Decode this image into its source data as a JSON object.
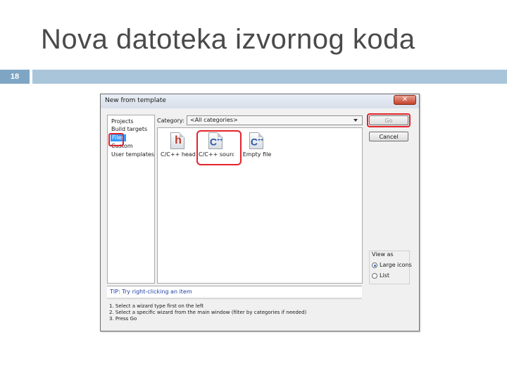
{
  "slide": {
    "title": "Nova datoteka izvornog koda",
    "number": "18"
  },
  "dialog": {
    "title": "New from template",
    "close_symbol": "✕",
    "left_items": [
      {
        "label": "Projects",
        "selected": false
      },
      {
        "label": "Build targets",
        "selected": false
      },
      {
        "label": "Files",
        "selected": true
      },
      {
        "label": "Custom",
        "selected": false
      },
      {
        "label": "User templates",
        "selected": false
      }
    ],
    "category_label": "Category:",
    "category_value": "<All categories>",
    "templates": [
      {
        "label": "C/C++ header",
        "glyph": "h",
        "icon": "header-file-icon"
      },
      {
        "label": "C/C++ source",
        "glyph": "C",
        "icon": "cpp-source-file-icon"
      },
      {
        "label": "Empty file",
        "glyph": "C",
        "icon": "empty-file-icon"
      }
    ],
    "buttons": {
      "go": "Go",
      "cancel": "Cancel"
    },
    "view_as": {
      "title": "View as",
      "options": [
        {
          "label": "Large icons",
          "checked": true
        },
        {
          "label": "List",
          "checked": false
        }
      ]
    },
    "tip": "TIP: Try right-clicking an item",
    "instructions": [
      "1. Select a wizard type first on the left",
      "2. Select a specific wizard from the main window (filter by categories if needed)",
      "3. Press Go"
    ],
    "highlight_color": "#e3232c"
  }
}
